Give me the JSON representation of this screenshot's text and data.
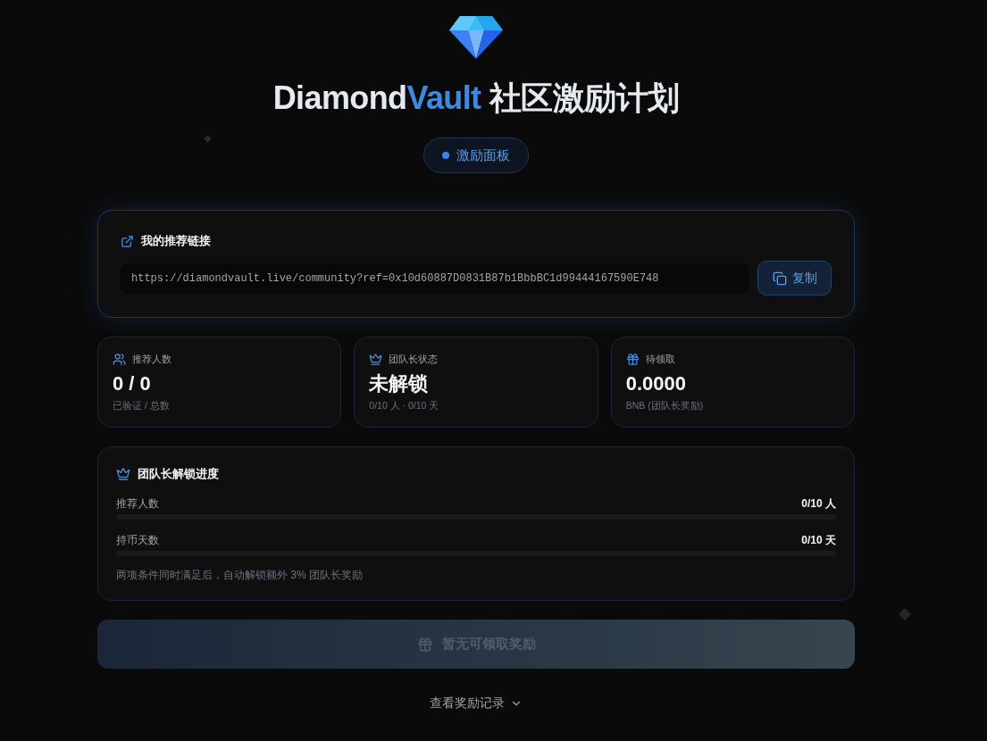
{
  "header": {
    "title": {
      "brand": "Diamond",
      "accent": "Vault",
      "suffix": "社区激励计划"
    },
    "badge": {
      "label": "激励面板"
    }
  },
  "referral": {
    "title": "我的推荐链接",
    "link": "https://diamondvault.live/community?ref=0x10d60887D0831B87b1BbbBC1d99444167590E748",
    "copy_button": "复制"
  },
  "stats": [
    {
      "kind": "users",
      "label": "推荐人数",
      "value": "0 / 0",
      "caption": "已验证 / 总数"
    },
    {
      "kind": "crown",
      "label": "团队长状态",
      "value": "未解锁",
      "caption": "0/10 人 · 0/10 天"
    },
    {
      "kind": "gift",
      "label": "待领取",
      "value": "0.0000",
      "caption": "BNB (团队长奖励)"
    }
  ],
  "progress": {
    "title": "团队长解锁进度",
    "rows": [
      {
        "label": "推荐人数",
        "reading": "0/10 人",
        "level": 0
      },
      {
        "label": "持币天数",
        "reading": "0/10 天",
        "level": 0
      }
    ],
    "note": "两项条件同时满足后，自动解锁额外 3% 团队长奖励"
  },
  "claim_button": {
    "label": "暂无可领取奖励",
    "disabled": true
  },
  "history_link": {
    "label": "查看奖励记录",
    "expanded": false
  }
}
